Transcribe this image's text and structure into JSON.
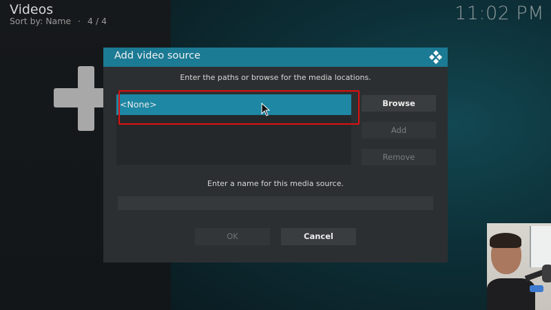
{
  "header": {
    "title": "Videos",
    "sort_text": "Sort by: Name",
    "separator": "·",
    "count": "4 / 4",
    "subtitle": "Sort by: Name  ·  4 / 4"
  },
  "clock": "11:02 PM",
  "dialog": {
    "title": "Add video source",
    "logo_icon": "kodi-logo-icon",
    "paths_instruction": "Enter the paths or browse for the media locations.",
    "paths": [
      {
        "label": "<None>",
        "selected": true
      }
    ],
    "buttons": {
      "browse": "Browse",
      "add": "Add",
      "remove": "Remove",
      "ok": "OK",
      "cancel": "Cancel"
    },
    "name_instruction": "Enter a name for this media source.",
    "name_value": "",
    "name_placeholder": ""
  },
  "colors": {
    "accent": "#1d87a4",
    "header_bar": "#1b7a94",
    "annotation": "#e01010"
  },
  "background_icon": "plus-icon",
  "cursor_icon": "mouse-pointer-icon"
}
